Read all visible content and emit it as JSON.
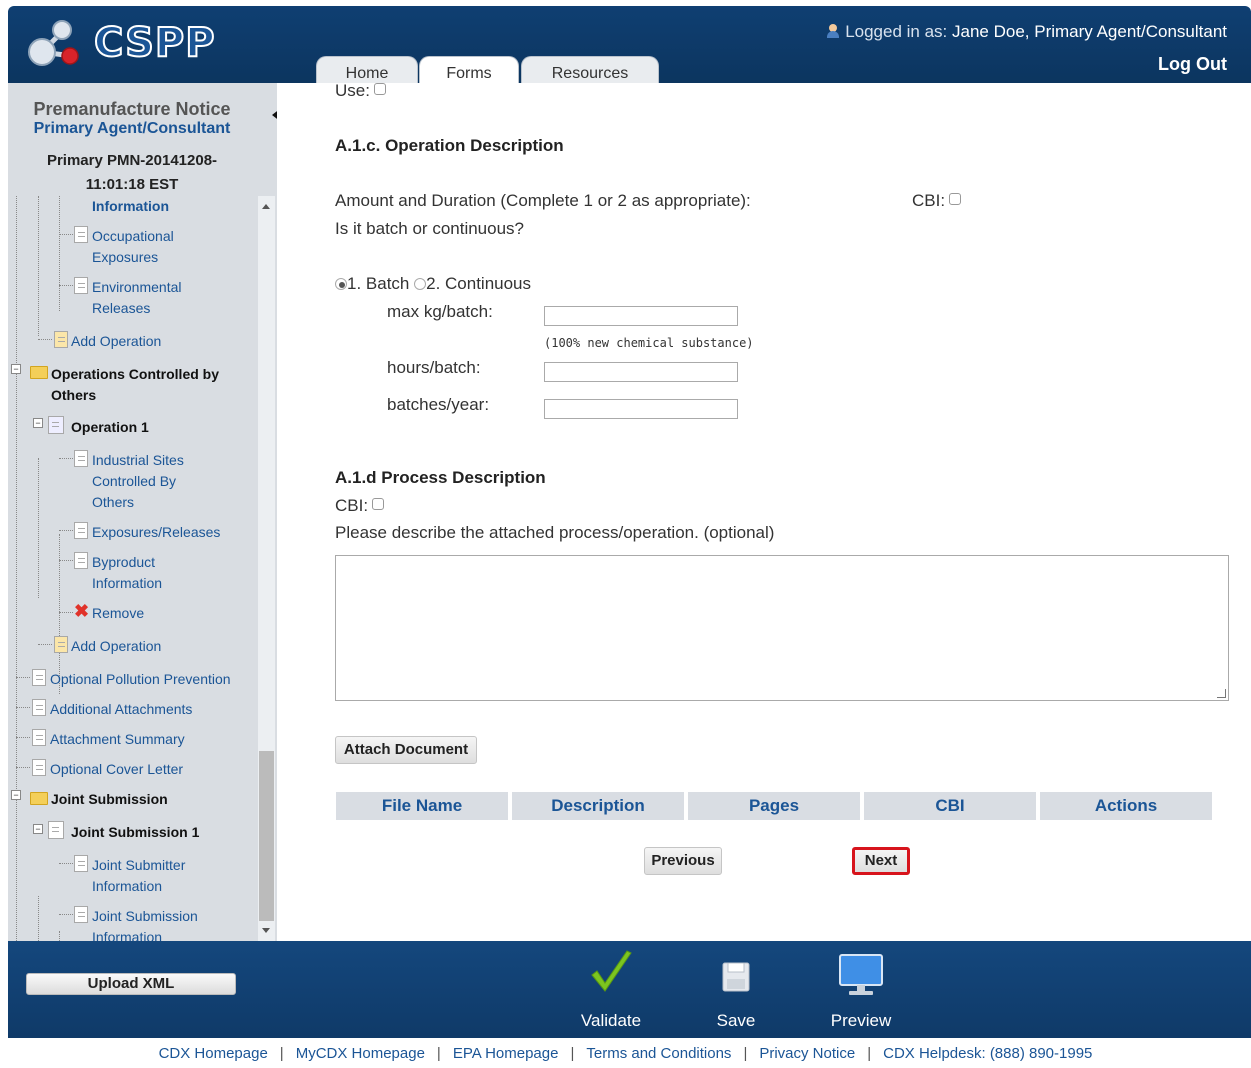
{
  "header": {
    "app_name": "CSPP",
    "logged_in_prefix": "Logged in as:",
    "user": "Jane Doe, Primary Agent/Consultant",
    "logout": "Log Out",
    "tabs": [
      "Home",
      "Forms",
      "Resources"
    ],
    "active_tab": "Forms"
  },
  "sidebar": {
    "title": "Premanufacture Notice",
    "role": "Primary Agent/Consultant",
    "submission_line1": "Primary PMN-20141208-",
    "submission_line2": "11:01:18 EST",
    "tree": {
      "information": "Information",
      "occupational_1": "Occupational",
      "occupational_2": "Exposures",
      "environmental_1": "Environmental",
      "environmental_2": "Releases",
      "add_operation_1": "Add Operation",
      "ops_controlled_1": "Operations Controlled by",
      "ops_controlled_2": "Others",
      "operation_1": "Operation 1",
      "industrial_1": "Industrial Sites",
      "industrial_2": "Controlled By",
      "industrial_3": "Others",
      "exposures_releases": "Exposures/Releases",
      "byproduct_1": "Byproduct",
      "byproduct_2": "Information",
      "remove": "Remove",
      "add_operation_2": "Add Operation",
      "optional_pollution": "Optional Pollution Prevention",
      "additional_attachments": "Additional Attachments",
      "attachment_summary": "Attachment Summary",
      "optional_cover_letter": "Optional Cover Letter",
      "joint_submission": "Joint Submission",
      "joint_submission_1": "Joint Submission 1",
      "joint_submitter_1": "Joint Submitter",
      "joint_submitter_2": "Information",
      "joint_submission_info_1": "Joint Submission",
      "joint_submission_info_2": "Information"
    }
  },
  "form": {
    "use_label": "Use:",
    "section_a1c": "A.1.c. Operation Description",
    "amount_duration": "Amount and Duration (Complete 1 or 2 as appropriate):",
    "cbi_label": "CBI:",
    "batch_question": "Is it batch or continuous?",
    "option_batch": "1. Batch",
    "option_continuous": "2. Continuous",
    "selected_option": "1. Batch",
    "max_kg_label": "max kg/batch:",
    "max_kg_value": "",
    "max_kg_hint": "(100% new chemical substance)",
    "hours_label": "hours/batch:",
    "hours_value": "",
    "batches_label": "batches/year:",
    "batches_value": "",
    "section_a1d": "A.1.d Process Description",
    "process_cbi_label": "CBI:",
    "process_prompt": "Please describe the attached process/operation. (optional)",
    "process_value": "",
    "attach_button": "Attach Document",
    "table_headers": [
      "File Name",
      "Description",
      "Pages",
      "CBI",
      "Actions"
    ],
    "previous_button": "Previous",
    "next_button": "Next"
  },
  "toolbar": {
    "upload_xml": "Upload XML",
    "validate": "Validate",
    "save": "Save",
    "preview": "Preview"
  },
  "footer": {
    "links": [
      "CDX Homepage",
      "MyCDX Homepage",
      "EPA Homepage",
      "Terms and Conditions",
      "Privacy Notice",
      "CDX Helpdesk: (888) 890-1995"
    ]
  },
  "colors": {
    "header_navy": "#0f3f72",
    "link_blue": "#1b5596",
    "sidebar_gray": "#d9dde2",
    "next_highlight": "#d7141c",
    "validate_green": "#7cc520"
  }
}
